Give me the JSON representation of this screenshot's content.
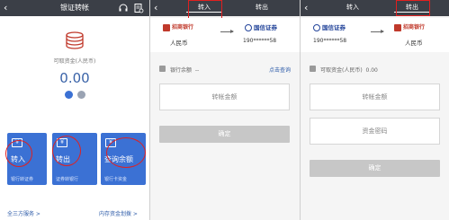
{
  "panel1": {
    "title": "银证转帐",
    "balance_label": "可取资金(人民币)",
    "balance_value": "0.00",
    "cards": [
      {
        "title": "转入",
        "subtitle": "银行转证券"
      },
      {
        "title": "转出",
        "subtitle": "证券转银行"
      },
      {
        "title": "查询余额",
        "subtitle": "银行卡资金"
      }
    ],
    "footer_left": "全三方服务 >",
    "footer_right": "内存资金划拨 >"
  },
  "panel2": {
    "tabs": [
      "转入",
      "转出"
    ],
    "active_tab": "转入",
    "bank_name": "招商银行",
    "bank_sub": "CMBCHINA",
    "broker_name": "国信证券",
    "currency": "人民币",
    "account": "190******58",
    "info_label": "银行余额",
    "info_value": "--",
    "info_link": "点击查询",
    "amount_placeholder": "转帐金额",
    "confirm": "确定"
  },
  "panel3": {
    "tabs": [
      "转入",
      "转出"
    ],
    "active_tab": "转出",
    "bank_name": "招商银行",
    "bank_sub": "CMBCHINA",
    "broker_name": "国信证券",
    "account": "190******58",
    "currency": "人民币",
    "info_label": "可取资金(人民币)",
    "info_value": "0.00",
    "amount_placeholder": "转帐金额",
    "password_placeholder": "资金密码",
    "confirm": "确定"
  },
  "colors": {
    "topbar": "#3b3f47",
    "card_blue": "#3b71d4",
    "link_blue": "#2c5aa8",
    "highlight_red": "#e02020"
  },
  "icons": [
    "back-arrow-icon",
    "headset-icon",
    "receipt-icon",
    "coins-icon",
    "bank-balance-icon"
  ]
}
